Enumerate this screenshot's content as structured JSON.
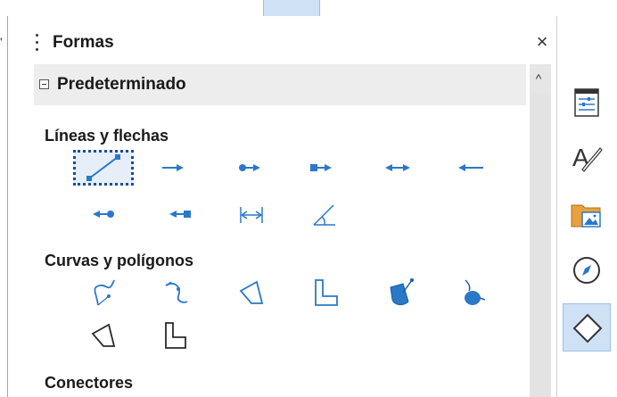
{
  "panel": {
    "title": "Formas",
    "close_glyph": "×",
    "menu_icon": "hamburger-icon"
  },
  "category": {
    "title": "Predeterminado",
    "expanded": true
  },
  "sections": {
    "lines": {
      "label": "Líneas y flechas",
      "items": [
        "line-icon",
        "line-ends-with-arrow-icon",
        "line-circle-arrow-icon",
        "line-square-arrow-icon",
        "double-arrow-line-icon",
        "line-starts-with-arrow-icon",
        "line-arrow-circle-icon",
        "line-arrow-square-icon",
        "dimension-line-icon",
        "angle-line-icon"
      ],
      "selected_index": 0
    },
    "curves": {
      "label": "Curvas y polígonos",
      "items": [
        "curve-icon",
        "freeform-line-icon",
        "polygon-45-icon",
        "polygon-icon",
        "filled-curve-icon",
        "filled-freeform-icon",
        "filled-polygon-45-icon",
        "filled-polygon-icon"
      ]
    },
    "connectors": {
      "label": "Conectores"
    }
  },
  "scrollbar": {
    "up_glyph": "^"
  },
  "sidebar_deck": {
    "items": [
      "properties-icon",
      "styles-icon",
      "gallery-icon",
      "navigator-icon",
      "shapes-icon"
    ],
    "active": "shapes-icon"
  },
  "colors": {
    "icon_blue": "#2a78c8",
    "selection_border": "#1b4f93",
    "header_bg": "#ededed",
    "active_deck_bg": "#cfe1f5"
  }
}
